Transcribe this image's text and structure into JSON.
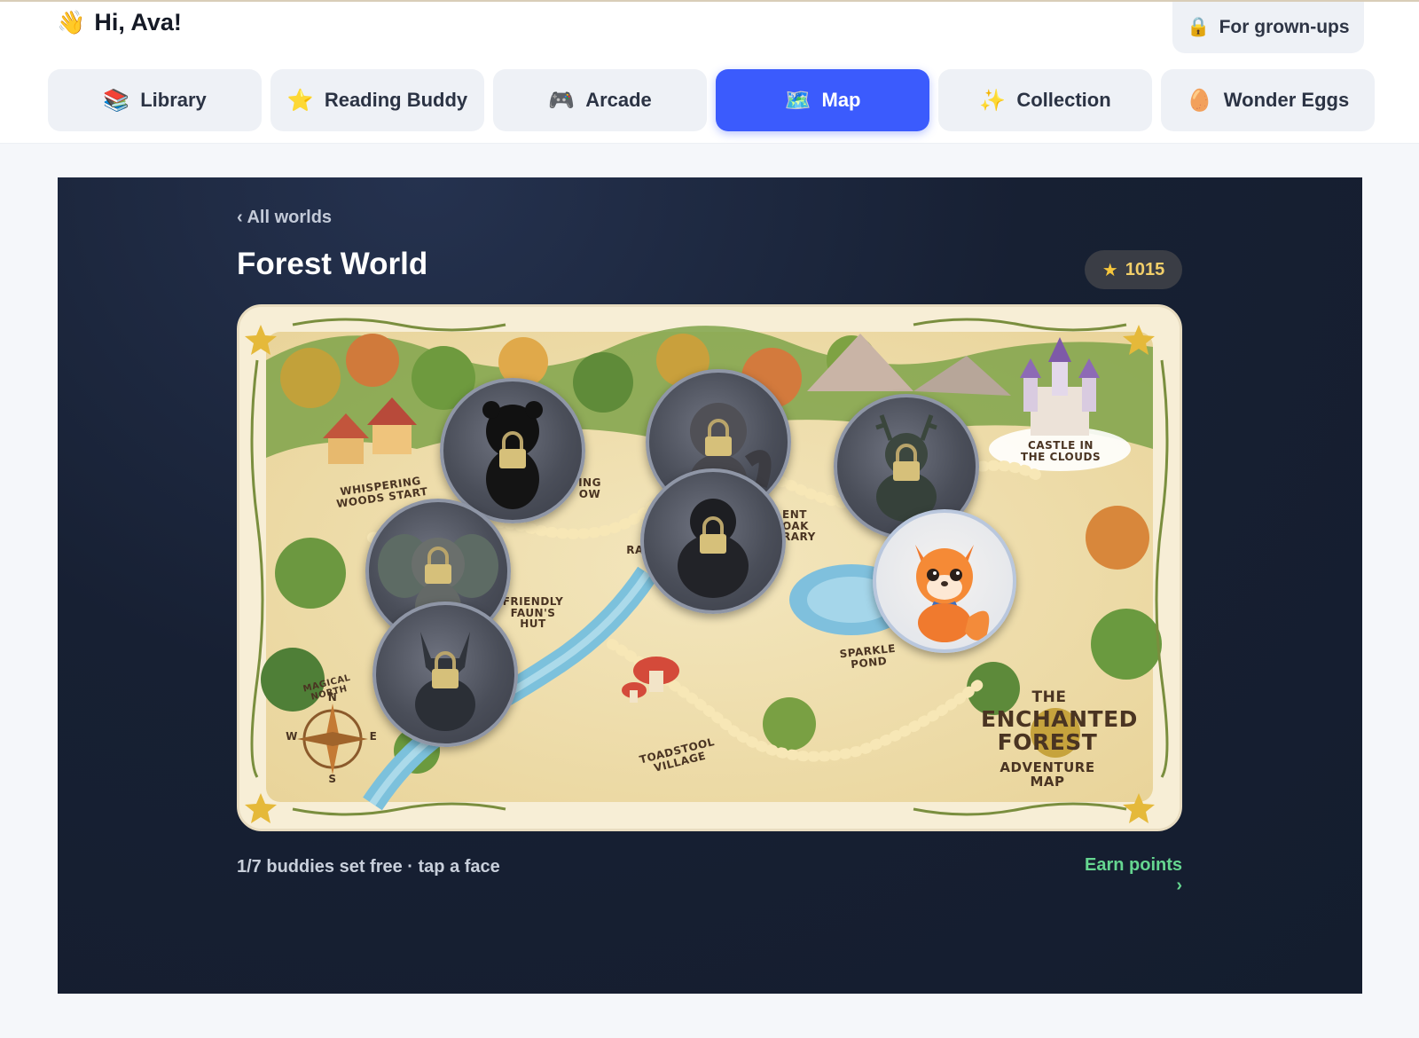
{
  "header": {
    "wave_icon": "waving-hand-icon",
    "greeting": "Hi, Ava!",
    "grownups_icon": "lock-icon",
    "grownups_label": "For grown-ups"
  },
  "tabs": [
    {
      "icon": "books-icon",
      "glyph": "📚",
      "label": "Library",
      "active": false
    },
    {
      "icon": "star-icon",
      "glyph": "⭐",
      "label": "Reading Buddy",
      "active": false
    },
    {
      "icon": "gamepad-icon",
      "glyph": "🎮",
      "label": "Arcade",
      "active": false
    },
    {
      "icon": "map-icon",
      "glyph": "🗺️",
      "label": "Map",
      "active": true
    },
    {
      "icon": "sparkles-icon",
      "glyph": "✨",
      "label": "Collection",
      "active": false
    },
    {
      "icon": "egg-icon",
      "glyph": "🥚",
      "label": "Wonder Eggs",
      "active": false
    }
  ],
  "world": {
    "back_label": "‹ All worlds",
    "title": "Forest World",
    "points": "1015",
    "points_icon": "star-icon"
  },
  "map": {
    "labels": {
      "start": "Whispering Woods Start",
      "hollow": "ing ow",
      "library": "ent Oak rary",
      "castle": "Castle in the Clouds",
      "faun": "Friendly Faun's Hut",
      "ra": "Ra",
      "pond": "Sparkle Pond",
      "village": "Toadstool Village",
      "north": "Magical North",
      "compass_n": "N",
      "compass_s": "S",
      "compass_e": "E",
      "compass_w": "W",
      "title_the": "The",
      "title_main": "Enchanted Forest",
      "title_sub": "Adventure Map"
    },
    "buddies": [
      {
        "name": "black-bear-buddy",
        "status": "locked"
      },
      {
        "name": "fairy-owl-buddy",
        "status": "locked"
      },
      {
        "name": "wolf-buddy",
        "status": "locked"
      },
      {
        "name": "chipmunk-buddy",
        "status": "locked"
      },
      {
        "name": "gorilla-buddy",
        "status": "locked"
      },
      {
        "name": "deer-buddy",
        "status": "locked"
      },
      {
        "name": "fox-buddy",
        "status": "free"
      }
    ]
  },
  "footer": {
    "progress": "1/7 buddies set free · tap a face",
    "earn_label": "Earn points ›"
  },
  "colors": {
    "accent": "#3b5bfd",
    "panel": "#172033",
    "earn": "#65d690",
    "points": "#f2cf6a"
  }
}
